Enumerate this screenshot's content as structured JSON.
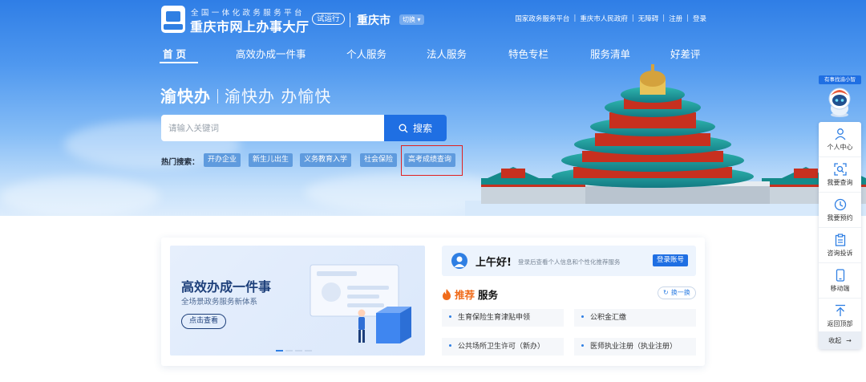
{
  "header": {
    "site_subtitle": "全国一体化政务服务平台",
    "site_title": "重庆市网上办事大厅",
    "trial_badge": "试运行",
    "city": "重庆市",
    "switch_label": "切换",
    "top_links": [
      "国家政务服务平台",
      "重庆市人民政府",
      "无障碍",
      "注册",
      "登录"
    ]
  },
  "nav": [
    "首页",
    "高效办成一件事",
    "个人服务",
    "法人服务",
    "特色专栏",
    "服务清单",
    "好差评"
  ],
  "hero": {
    "slogan_a": "渝快办",
    "slogan_b": "渝快办 办愉快"
  },
  "search": {
    "placeholder": "请输入关键词",
    "button": "搜索"
  },
  "hot": {
    "label": "热门搜索：",
    "tags": [
      "开办企业",
      "新生儿出生",
      "义务教育入学",
      "社会保险",
      "高考成绩查询"
    ]
  },
  "sidebar": {
    "badge": "有事找渝小智",
    "items": [
      "个人中心",
      "我要查询",
      "我要预约",
      "咨询投诉",
      "移动端",
      "返回顶部"
    ],
    "collapse": "收起"
  },
  "banner": {
    "title": "高效办成一件事",
    "subtitle": "全场景政务服务新体系",
    "button": "点击查看"
  },
  "greeting": {
    "title": "上午好!",
    "subtitle": "登录后查看个人信息和个性化推荐服务",
    "login": "登录账号"
  },
  "recommend": {
    "title_a": "推荐",
    "title_b": "服务",
    "refresh": "换一换",
    "items": [
      "生育保险生育津贴申领",
      "公积金汇缴",
      "公共场所卫生许可（新办）",
      "医师执业注册（执业注册）"
    ]
  },
  "colors": {
    "primary": "#1f6fe3",
    "hero_top": "#2f7ee6",
    "highlight": "#e02020",
    "orange": "#f06b1a"
  }
}
